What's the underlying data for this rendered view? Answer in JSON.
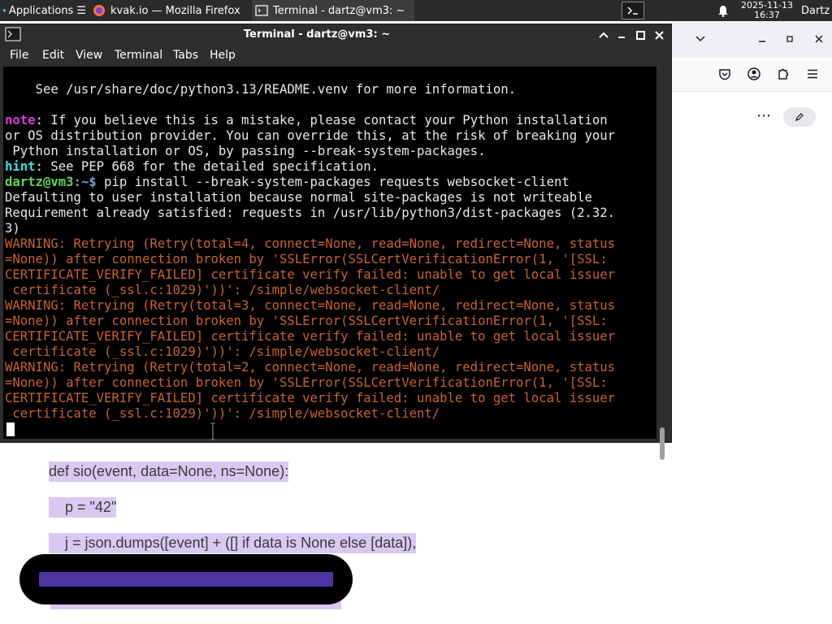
{
  "panel": {
    "applications_label": "Applications",
    "firefox_task_label": "kvak.io — Mozilla Firefox",
    "terminal_task_label": "Terminal - dartz@vm3: ~",
    "date": "2025-11-13",
    "time": "16:37",
    "user": "Dartz"
  },
  "terminal": {
    "title": "Terminal - dartz@vm3: ~",
    "menu": [
      "File",
      "Edit",
      "View",
      "Terminal",
      "Tabs",
      "Help"
    ],
    "lines": {
      "l1": "    See /usr/share/doc/python3.13/README.venv for more information.",
      "note_label": "note",
      "l3": ": If you believe this is a mistake, please contact your Python installation",
      "l4": "or OS distribution provider. You can override this, at the risk of breaking your",
      "l5": " Python installation or OS, by passing --break-system-packages.",
      "hint_label": "hint",
      "l6": ": See PEP 668 for the detailed specification.",
      "prompt_user": "dartz@vm3",
      "prompt_path": ":~$",
      "command": " pip install --break-system-packages requests websocket-client",
      "l8": "Defaulting to user installation because normal site-packages is not writeable",
      "l9": "Requirement already satisfied: requests in /usr/lib/python3/dist-packages (2.32.",
      "l10": "3)",
      "w1": "WARNING: Retrying (Retry(total=4, connect=None, read=None, redirect=None, status\n=None)) after connection broken by 'SSLError(SSLCertVerificationError(1, '[SSL:\nCERTIFICATE_VERIFY_FAILED] certificate verify failed: unable to get local issuer\n certificate (_ssl.c:1029)'))': /simple/websocket-client/",
      "w2": "WARNING: Retrying (Retry(total=3, connect=None, read=None, redirect=None, status\n=None)) after connection broken by 'SSLError(SSLCertVerificationError(1, '[SSL:\nCERTIFICATE_VERIFY_FAILED] certificate verify failed: unable to get local issuer\n certificate (_ssl.c:1029)'))': /simple/websocket-client/",
      "w3": "WARNING: Retrying (Retry(total=2, connect=None, read=None, redirect=None, status\n=None)) after connection broken by 'SSLError(SSLCertVerificationError(1, '[SSL:\nCERTIFICATE_VERIFY_FAILED] certificate verify failed: unable to get local issuer\n certificate (_ssl.c:1029)'))': /simple/websocket-client/"
    }
  },
  "document": {
    "line1": "def sio(event, data=None, ns=None):",
    "line2": "    p = \"42\"",
    "line3": "    j = json.dumps([event] + ([] if data is None else [data]),"
  },
  "colors": {
    "note": "#d63ad6",
    "hint": "#34e2e2",
    "prompt": "#5bd75b",
    "warning": "#c8642a",
    "selection": "#d9c9f2"
  }
}
